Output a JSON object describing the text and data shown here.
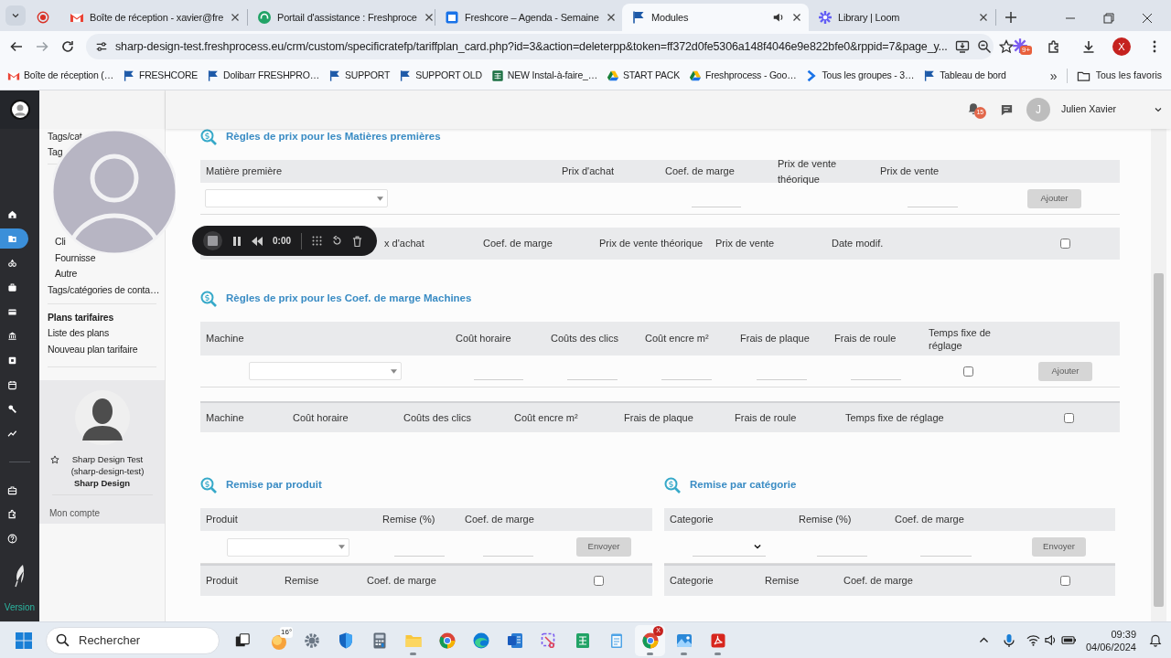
{
  "browser": {
    "tabs": [
      {
        "title": "Boîte de réception - xavier@fre",
        "kind": "mail",
        "selected": false,
        "audio": false
      },
      {
        "title": "Portail d'assistance : Freshproce",
        "kind": "support",
        "selected": false,
        "audio": false
      },
      {
        "title": "Freshcore – Agenda - Semaine",
        "kind": "calendar",
        "selected": false,
        "audio": false
      },
      {
        "title": "Modules",
        "kind": "flag",
        "selected": true,
        "audio": true
      },
      {
        "title": "Library | Loom",
        "kind": "loom",
        "selected": false,
        "audio": false
      }
    ],
    "url": "sharp-design-test.freshprocess.eu/crm/custom/specificratefp/tariffplan_card.php?id=3&action=deleterpp&token=ff372d0fe5306a148f4046e9e822bfe0&rppid=7&page_y...",
    "extension_badge": "9+",
    "profile_initial": "X",
    "bookmarks": [
      {
        "label": "Boîte de réception (…",
        "kind": "mail"
      },
      {
        "label": "FRESHCORE",
        "kind": "flag"
      },
      {
        "label": "Dolibarr FRESHPRO…",
        "kind": "flag"
      },
      {
        "label": "SUPPORT",
        "kind": "flag"
      },
      {
        "label": "SUPPORT OLD",
        "kind": "flag"
      },
      {
        "label": "NEW Instal-à-faire_…",
        "kind": "sheet"
      },
      {
        "label": "START PACK",
        "kind": "drive"
      },
      {
        "label": "Freshprocess - Goo…",
        "kind": "drive"
      },
      {
        "label": "Tous les groupes - 3…",
        "kind": "chevron"
      },
      {
        "label": "Tableau de bord",
        "kind": "flag"
      }
    ],
    "more_bookmarks": "»",
    "all_bookmarks": "Tous les favoris"
  },
  "app": {
    "rail": [
      {
        "kind": "home",
        "selected": false
      },
      {
        "kind": "folder",
        "selected": true
      },
      {
        "kind": "shapes",
        "selected": false
      },
      {
        "kind": "briefcase",
        "selected": false
      },
      {
        "kind": "card",
        "selected": false
      },
      {
        "kind": "bank",
        "selected": false
      },
      {
        "kind": "box",
        "selected": false
      },
      {
        "kind": "calendar",
        "selected": false
      },
      {
        "kind": "wrench",
        "selected": false
      },
      {
        "kind": "chart",
        "selected": false
      }
    ],
    "rail_bottom": [
      {
        "kind": "toolbox",
        "selected": false
      },
      {
        "kind": "puzzle",
        "selected": false
      },
      {
        "kind": "help",
        "selected": false
      }
    ],
    "version": "Version",
    "topbar": {
      "notifications": "15",
      "user_initial": "J",
      "user_name": "Julien Xavier"
    },
    "menu": {
      "top_items": [
        {
          "label": "Tags/cat"
        },
        {
          "label": "Tag"
        }
      ],
      "children": [
        {
          "label": "Cli"
        },
        {
          "label": "Fournisse"
        },
        {
          "label": "Autre"
        }
      ],
      "items": [
        {
          "label": "Tags/catégories de conta…"
        }
      ],
      "plans": {
        "title": "Plans tarifaires",
        "items": [
          {
            "label": "Liste des plans"
          },
          {
            "label": "Nouveau plan tarifaire"
          }
        ]
      }
    },
    "user_card": {
      "name": "Sharp Design Test (sharp-design-test)",
      "company": "Sharp Design",
      "link": "Mon compte"
    }
  },
  "sections": [
    {
      "kind": "materials",
      "title": "Règles de prix pour les Matières premières",
      "form_header": [
        "Matière première",
        "Prix d'achat",
        "Coef. de marge",
        "Prix de vente théorique",
        "Prix de vente"
      ],
      "form": [
        {
          "kind": "select"
        },
        {
          "kind": "field"
        },
        {
          "kind": "field"
        },
        {
          "kind": "button",
          "label": "Ajouter",
          "disabled": true
        }
      ],
      "list_header": [
        "x d'achat",
        "Coef. de marge",
        "Prix de vente théorique",
        "Prix de vente",
        "Date modif."
      ],
      "list_checkbox": {
        "checked": false
      }
    },
    {
      "kind": "machines",
      "title": "Règles de prix pour les Coef. de marge Machines",
      "form_header": [
        "Machine",
        "Coût horaire",
        "Coûts des clics",
        "Coût encre m²",
        "Frais de plaque",
        "Frais de roule",
        "Temps fixe de réglage"
      ],
      "form": [
        {
          "kind": "select"
        },
        {
          "kind": "field"
        },
        {
          "kind": "field"
        },
        {
          "kind": "field"
        },
        {
          "kind": "field"
        },
        {
          "kind": "field"
        },
        {
          "kind": "checkbox",
          "checked": false
        },
        {
          "kind": "button",
          "label": "Ajouter",
          "disabled": true
        }
      ],
      "list_header": [
        "Machine",
        "Coût horaire",
        "Coûts des clics",
        "Coût encre m²",
        "Frais de plaque",
        "Frais de roule",
        "Temps fixe de réglage"
      ],
      "list_checkbox": {
        "checked": false
      }
    },
    {
      "kind": "product",
      "title": "Remise par produit",
      "form_header": [
        "Produit",
        "Remise (%)",
        "Coef. de marge"
      ],
      "form": [
        {
          "kind": "select"
        },
        {
          "kind": "field"
        },
        {
          "kind": "field"
        },
        {
          "kind": "button",
          "label": "Envoyer",
          "disabled": true
        }
      ],
      "list_header": [
        "Produit",
        "Remise",
        "Coef. de marge"
      ],
      "list_checkbox": {
        "checked": false
      }
    },
    {
      "kind": "category",
      "title": "Remise par catégorie",
      "form_header": [
        "Categorie",
        "Remise (%)",
        "Coef. de marge"
      ],
      "form": [
        {
          "kind": "native-select"
        },
        {
          "kind": "field"
        },
        {
          "kind": "field"
        },
        {
          "kind": "button",
          "label": "Envoyer",
          "disabled": true
        }
      ],
      "list_header": [
        "Categorie",
        "Remise",
        "Coef. de marge"
      ],
      "list_checkbox": {
        "checked": false
      }
    }
  ],
  "recorder": {
    "time": "0:00"
  },
  "taskbar": {
    "search": {
      "placeholder": "Rechercher"
    },
    "weather": "16°",
    "apps": [
      {
        "kind": "settings",
        "running": false,
        "selected": false
      },
      {
        "kind": "shield",
        "running": false,
        "selected": false
      },
      {
        "kind": "calculator",
        "running": false,
        "selected": false
      },
      {
        "kind": "explorer",
        "running": true,
        "selected": false
      },
      {
        "kind": "chrome",
        "running": false,
        "selected": false
      },
      {
        "kind": "edge",
        "running": false,
        "selected": false
      },
      {
        "kind": "word",
        "running": false,
        "selected": false
      },
      {
        "kind": "snip",
        "running": false,
        "selected": false
      },
      {
        "kind": "sheet",
        "running": false,
        "selected": false
      },
      {
        "kind": "notepad",
        "running": false,
        "selected": false
      },
      {
        "kind": "chrome",
        "running": true,
        "selected": true,
        "badge": "X"
      },
      {
        "kind": "photos",
        "running": true,
        "selected": false
      },
      {
        "kind": "acrobat",
        "running": true,
        "selected": false
      }
    ],
    "time": "09:39",
    "date": "04/06/2024"
  }
}
